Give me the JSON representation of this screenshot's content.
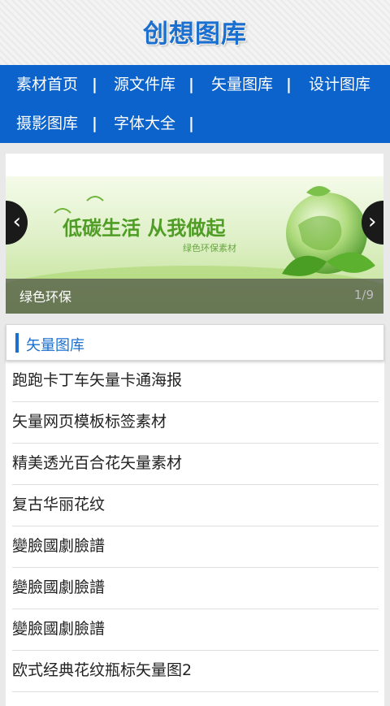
{
  "header": {
    "title": "创想图库"
  },
  "nav": {
    "items": [
      {
        "label": "素材首页"
      },
      {
        "label": "源文件库"
      },
      {
        "label": "矢量图库"
      },
      {
        "label": "设计图库"
      },
      {
        "label": "摄影图库"
      },
      {
        "label": "字体大全"
      }
    ],
    "separator": "|"
  },
  "slider": {
    "banner_text": "低碳生活 从我做起",
    "banner_subtext": "绿色环保素材",
    "caption": "绿色环保",
    "counter": "1/9",
    "prev_icon": "chevron-left-icon",
    "next_icon": "chevron-right-icon"
  },
  "section": {
    "title": "矢量图库",
    "accent_color": "#1a6fcf",
    "items": [
      {
        "label": "跑跑卡丁车矢量卡通海报"
      },
      {
        "label": "矢量网页模板标签素材"
      },
      {
        "label": "精美透光百合花矢量素材"
      },
      {
        "label": "复古华丽花纹"
      },
      {
        "label": "變臉國劇臉譜"
      },
      {
        "label": "變臉國劇臉譜"
      },
      {
        "label": "變臉國劇臉譜"
      },
      {
        "label": "欧式经典花纹瓶标矢量图2"
      }
    ]
  }
}
